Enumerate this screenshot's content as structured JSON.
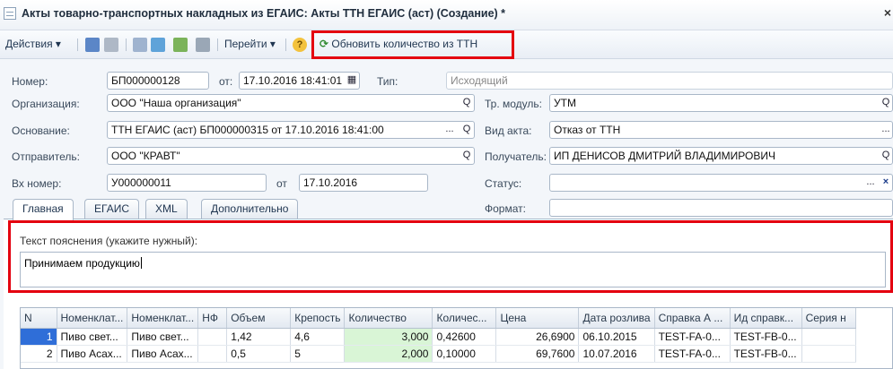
{
  "window": {
    "title": "Акты товарно-транспортных накладных из ЕГАИС: Акты ТТН ЕГАИС (аст) (Создание) *",
    "close_glyph": "×"
  },
  "toolbar": {
    "actions_label": "Действия",
    "goto_label": "Перейти",
    "help_glyph": "?",
    "refresh_label": "Обновить количество из ТТН",
    "dropdown_glyph": "▾"
  },
  "form": {
    "number_label": "Номер:",
    "number_value": "БП000000128",
    "from_label": "от:",
    "date_value": "17.10.2016 18:41:01",
    "type_label": "Тип:",
    "type_value": "Исходящий",
    "org_label": "Организация:",
    "org_value": "ООО \"Наша организация\"",
    "trmodule_label": "Тр. модуль:",
    "trmodule_value": "УТМ",
    "basis_label": "Основание:",
    "basis_value": "ТТН ЕГАИС (аст) БП000000315 от 17.10.2016 18:41:00",
    "act_type_label": "Вид акта:",
    "act_type_value": "Отказ от ТТН",
    "sender_label": "Отправитель:",
    "sender_value": "ООО \"КРАВТ\"",
    "receiver_label": "Получатель:",
    "receiver_value": "ИП ДЕНИСОВ ДМИТРИЙ ВЛАДИМИРОВИЧ",
    "in_number_label": "Вх номер:",
    "in_number_value": "У000000011",
    "in_from_label": "от",
    "in_date_value": "17.10.2016",
    "status_label": "Статус:",
    "status_value": "",
    "format_label": "Формат:",
    "format_value": "",
    "select_glyph": "...",
    "search_glyph": "Q",
    "clear_glyph": "×",
    "calendar_glyph": "▦"
  },
  "tabs": [
    "Главная",
    "ЕГАИС",
    "XML",
    "Дополнительно"
  ],
  "explanation": {
    "label": "Текст пояснения (укажите нужный):",
    "value": "Принимаем продукцию"
  },
  "table": {
    "columns": [
      "N",
      "Номенклат...",
      "Номенклат...",
      "НФ",
      "Объем",
      "Крепость",
      "Количество",
      "Количес...",
      "Цена",
      "Дата розлива",
      "Справка А ...",
      "Ид справк...",
      "Серия н"
    ],
    "rows": [
      [
        "1",
        "Пиво свет...",
        "Пиво свет...",
        "",
        "1,42",
        "4,6",
        "3,000",
        "0,42600",
        "26,6900",
        "06.10.2015",
        "TEST-FA-0...",
        "TEST-FB-0...",
        ""
      ],
      [
        "2",
        "Пиво Асах...",
        "Пиво Асах...",
        "",
        "0,5",
        "5",
        "2,000",
        "0,10000",
        "69,7600",
        "10.07.2016",
        "TEST-FA-0...",
        "TEST-FB-0...",
        ""
      ]
    ]
  },
  "colors": {
    "highlight": "#e4000f",
    "quantity_bg": "#d9f5d6",
    "selection": "#2f6ed8"
  }
}
